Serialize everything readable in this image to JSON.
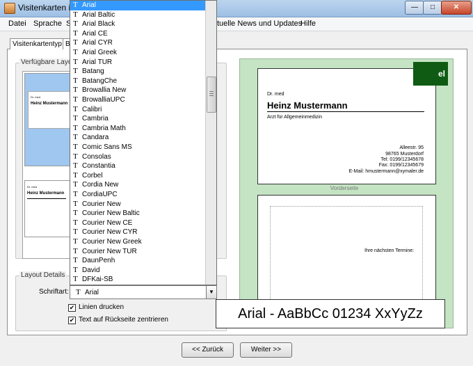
{
  "window": {
    "title": "Visitenkarten in",
    "min": "—",
    "max": "□",
    "close": "✕"
  },
  "menu": [
    "Datei",
    "Sprache",
    "S",
    "tuelle News und Updates",
    "Hilfe"
  ],
  "tabs": [
    "Visitenkartentyp",
    "B"
  ],
  "layouts": {
    "group_label": "Verfügbare Layou",
    "thumb_title": "Dr. med",
    "thumb_name": "Heinz Mustermann"
  },
  "details": {
    "group_label": "Layout Details",
    "font_label": "Schriftart:",
    "font_value": "Arial",
    "print_lines": "Linien drucken",
    "center_text": "Text auf Rückseite zentrieren"
  },
  "card": {
    "title": "Dr. med",
    "name": "Heinz Mustermann",
    "subtitle": "Arzt für Allgemeinmedizin",
    "logo_text": "el",
    "street": "Alleestr. 95",
    "city": "98765 Musterdorf",
    "tel": "Tel: 0199/12345678",
    "fax": "Fax: 0199/12345679",
    "email": "E-Mail: hmustermann@xymaler.de",
    "front_label": "Vorderseite",
    "appointments": "Ihre nächsten Termine:"
  },
  "font_preview": "Arial - AaBbCc 01234 XxYyZz",
  "buttons": {
    "back": "<< Zurück",
    "next": "Weiter >>"
  },
  "font_list": [
    "Arial",
    "Arial Baltic",
    "Arial Black",
    "Arial CE",
    "Arial CYR",
    "Arial Greek",
    "Arial TUR",
    "Batang",
    "BatangChe",
    "Browallia New",
    "BrowalliaUPC",
    "Calibri",
    "Cambria",
    "Cambria Math",
    "Candara",
    "Comic Sans MS",
    "Consolas",
    "Constantia",
    "Corbel",
    "Cordia New",
    "CordiaUPC",
    "Courier New",
    "Courier New Baltic",
    "Courier New CE",
    "Courier New CYR",
    "Courier New Greek",
    "Courier New TUR",
    "DaunPenh",
    "David",
    "DFKai-SB"
  ],
  "icons": {
    "font_type": "T",
    "dropdown_arrow": "▼"
  }
}
